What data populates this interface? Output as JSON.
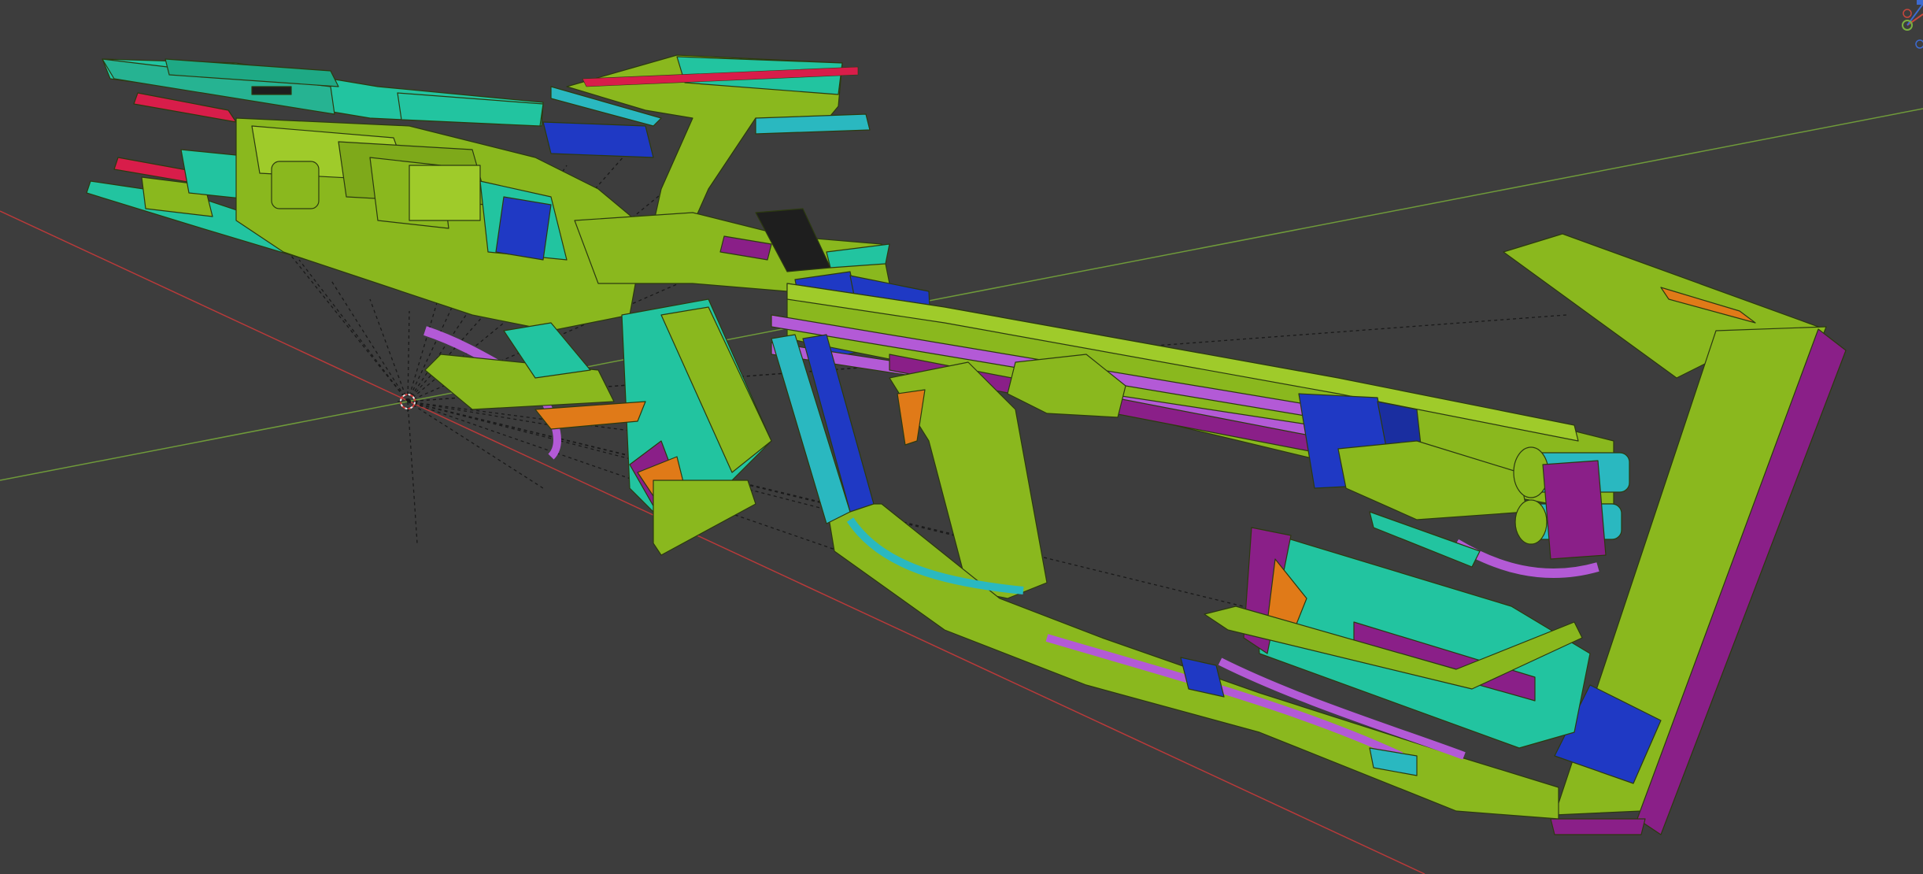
{
  "viewport": {
    "background_color": "#3d3d3d",
    "x_axis_color": "#b83a3a",
    "y_axis_color": "#6f9a3a",
    "object": "rifle-model",
    "material_colors": {
      "lime": "#8ab81e",
      "lime_dark": "#6f9616",
      "teal": "#22c4a0",
      "cyan": "#2ab8c0",
      "blue": "#1f39c4",
      "purple": "#8a1f88",
      "violet": "#b35ad6",
      "red": "#d81d4a",
      "orange": "#e07a18",
      "black_screen": "#1e1e1e"
    }
  },
  "gizmo": {
    "x_color": "#c8463c",
    "y_color": "#7ab040",
    "z_color": "#3c6ad0"
  }
}
